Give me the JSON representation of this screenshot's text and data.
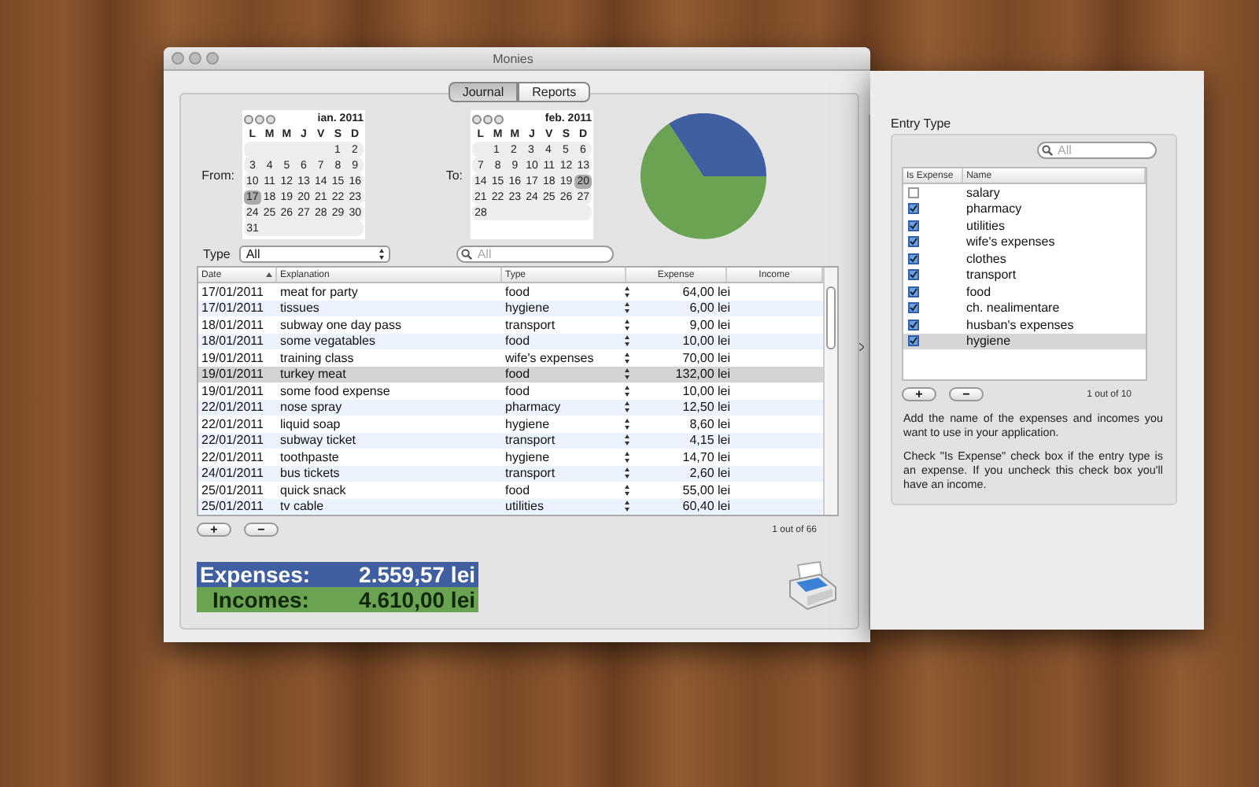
{
  "window": {
    "title": "Monies"
  },
  "tabs": [
    {
      "label": "Journal",
      "selected": true
    },
    {
      "label": "Reports",
      "selected": false
    }
  ],
  "from": {
    "label": "From:",
    "month": "ian. 2011",
    "weekdays": [
      "L",
      "M",
      "M",
      "J",
      "V",
      "S",
      "D"
    ],
    "weeks": [
      {
        "days": [
          {
            "day": "1",
            "selected": false
          },
          {
            "day": "2",
            "selected": false
          }
        ]
      },
      {
        "days": [
          {
            "day": "3",
            "selected": false
          },
          {
            "day": "4",
            "selected": false
          },
          {
            "day": "5",
            "selected": false
          },
          {
            "day": "6",
            "selected": false
          },
          {
            "day": "7",
            "selected": false
          },
          {
            "day": "8",
            "selected": false
          },
          {
            "day": "9",
            "selected": false
          }
        ]
      },
      {
        "days": [
          {
            "day": "10",
            "selected": false
          },
          {
            "day": "11",
            "selected": false
          },
          {
            "day": "12",
            "selected": false
          },
          {
            "day": "13",
            "selected": false
          },
          {
            "day": "14",
            "selected": false
          },
          {
            "day": "15",
            "selected": false
          },
          {
            "day": "16",
            "selected": false
          }
        ]
      },
      {
        "days": [
          {
            "day": "17",
            "selected": true
          },
          {
            "day": "18",
            "selected": false
          },
          {
            "day": "19",
            "selected": false
          },
          {
            "day": "20",
            "selected": false
          },
          {
            "day": "21",
            "selected": false
          },
          {
            "day": "22",
            "selected": false
          },
          {
            "day": "23",
            "selected": false
          }
        ]
      },
      {
        "days": [
          {
            "day": "24",
            "selected": false
          },
          {
            "day": "25",
            "selected": false
          },
          {
            "day": "26",
            "selected": false
          },
          {
            "day": "27",
            "selected": false
          },
          {
            "day": "28",
            "selected": false
          },
          {
            "day": "29",
            "selected": false
          },
          {
            "day": "30",
            "selected": false
          }
        ]
      },
      {
        "days": [
          {
            "day": "31",
            "selected": false
          }
        ]
      }
    ]
  },
  "to": {
    "label": "To:",
    "month": "feb. 2011",
    "weekdays": [
      "L",
      "M",
      "M",
      "J",
      "V",
      "S",
      "D"
    ],
    "weeks": [
      {
        "days": [
          {
            "day": "1",
            "selected": false
          },
          {
            "day": "2",
            "selected": false
          },
          {
            "day": "3",
            "selected": false
          },
          {
            "day": "4",
            "selected": false
          },
          {
            "day": "5",
            "selected": false
          },
          {
            "day": "6",
            "selected": false
          }
        ]
      },
      {
        "days": [
          {
            "day": "7",
            "selected": false
          },
          {
            "day": "8",
            "selected": false
          },
          {
            "day": "9",
            "selected": false
          },
          {
            "day": "10",
            "selected": false
          },
          {
            "day": "11",
            "selected": false
          },
          {
            "day": "12",
            "selected": false
          },
          {
            "day": "13",
            "selected": false
          }
        ]
      },
      {
        "days": [
          {
            "day": "14",
            "selected": false
          },
          {
            "day": "15",
            "selected": false
          },
          {
            "day": "16",
            "selected": false
          },
          {
            "day": "17",
            "selected": false
          },
          {
            "day": "18",
            "selected": false
          },
          {
            "day": "19",
            "selected": false
          },
          {
            "day": "20",
            "selected": true
          }
        ]
      },
      {
        "days": [
          {
            "day": "21",
            "selected": false
          },
          {
            "day": "22",
            "selected": false
          },
          {
            "day": "23",
            "selected": false
          },
          {
            "day": "24",
            "selected": false
          },
          {
            "day": "25",
            "selected": false
          },
          {
            "day": "26",
            "selected": false
          },
          {
            "day": "27",
            "selected": false
          }
        ]
      },
      {
        "days": [
          {
            "day": "28",
            "selected": false
          }
        ]
      }
    ]
  },
  "type_filter": {
    "label": "Type",
    "value": "All"
  },
  "search": {
    "placeholder": "All"
  },
  "table": {
    "columns": [
      "Date",
      "Explanation",
      "Type",
      "Expense",
      "Income"
    ],
    "rows": [
      {
        "date": "17/01/2011",
        "explanation": "meat for party",
        "type": "food",
        "expense": "64,00 lei",
        "selected": false
      },
      {
        "date": "17/01/2011",
        "explanation": "tissues",
        "type": "hygiene",
        "expense": "6,00 lei",
        "selected": false
      },
      {
        "date": "18/01/2011",
        "explanation": "subway one day pass",
        "type": "transport",
        "expense": "9,00 lei",
        "selected": false
      },
      {
        "date": "18/01/2011",
        "explanation": "some vegatables",
        "type": "food",
        "expense": "10,00 lei",
        "selected": false
      },
      {
        "date": "19/01/2011",
        "explanation": "training class",
        "type": "wife's expenses",
        "expense": "70,00 lei",
        "selected": false
      },
      {
        "date": "19/01/2011",
        "explanation": "turkey meat",
        "type": "food",
        "expense": "132,00 lei",
        "selected": true
      },
      {
        "date": "19/01/2011",
        "explanation": "some food expense",
        "type": "food",
        "expense": "10,00 lei",
        "selected": false
      },
      {
        "date": "22/01/2011",
        "explanation": "nose spray",
        "type": "pharmacy",
        "expense": "12,50 lei",
        "selected": false
      },
      {
        "date": "22/01/2011",
        "explanation": "liquid soap",
        "type": "hygiene",
        "expense": "8,60 lei",
        "selected": false
      },
      {
        "date": "22/01/2011",
        "explanation": "subway ticket",
        "type": "transport",
        "expense": "4,15 lei",
        "selected": false
      },
      {
        "date": "22/01/2011",
        "explanation": "toothpaste",
        "type": "hygiene",
        "expense": "14,70 lei",
        "selected": false
      },
      {
        "date": "24/01/2011",
        "explanation": "bus tickets",
        "type": "transport",
        "expense": "2,60 lei",
        "selected": false
      },
      {
        "date": "25/01/2011",
        "explanation": "quick snack",
        "type": "food",
        "expense": "55,00 lei",
        "selected": false
      },
      {
        "date": "25/01/2011",
        "explanation": "tv cable",
        "type": "utilities",
        "expense": "60,40 lei",
        "selected": false
      }
    ]
  },
  "table_buttons": [
    "+",
    "−"
  ],
  "count": "1 out of 66",
  "totals": [
    {
      "label": "Expenses:",
      "value": "2.559,57 lei",
      "color": "#3f5fa0"
    },
    {
      "label": "Incomes:",
      "value": "4.610,00 lei",
      "color": "#6aa452"
    }
  ],
  "drawer": {
    "title": "Entry Type",
    "search": {
      "placeholder": "All"
    },
    "columns": [
      "Is Expense",
      "Name"
    ],
    "items": [
      {
        "name": "salary",
        "checked": false,
        "selected": false
      },
      {
        "name": "pharmacy",
        "checked": true,
        "selected": false
      },
      {
        "name": "utilities",
        "checked": true,
        "selected": false
      },
      {
        "name": "wife's expenses",
        "checked": true,
        "selected": false
      },
      {
        "name": "clothes",
        "checked": true,
        "selected": false
      },
      {
        "name": "transport",
        "checked": true,
        "selected": false
      },
      {
        "name": "food",
        "checked": true,
        "selected": false
      },
      {
        "name": "ch. nealimentare",
        "checked": true,
        "selected": false
      },
      {
        "name": "husban's expenses",
        "checked": true,
        "selected": false
      },
      {
        "name": "hygiene",
        "checked": true,
        "selected": true
      }
    ],
    "buttons": [
      "+",
      "−"
    ],
    "count": "1 out of 10",
    "help": [
      "Add the name of the expenses and incomes you want to use in your application.",
      "Check \"Is Expense\" check box if the entry type is an expense. If you uncheck this check box you'll have an income."
    ]
  }
}
